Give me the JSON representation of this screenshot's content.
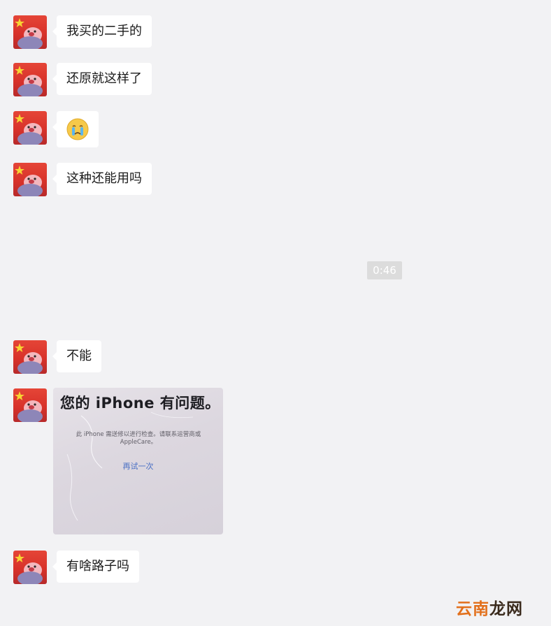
{
  "messages": [
    {
      "type": "text",
      "text": "我买的二手的"
    },
    {
      "type": "text",
      "text": "还原就这样了"
    },
    {
      "type": "emoji",
      "emoji": "crying-face-emoji"
    },
    {
      "type": "text",
      "text": "这种还能用吗"
    },
    {
      "type": "timestamp",
      "text": "0:46"
    },
    {
      "type": "text",
      "text": "不能"
    },
    {
      "type": "image",
      "title": "您的 iPhone 有问题。",
      "body": "此 iPhone 需送修以进行检查。请联系运营商或 AppleCare。",
      "link": "再试一次"
    },
    {
      "type": "text",
      "text": "有啥路子吗"
    }
  ],
  "watermark": {
    "part1": "云南",
    "part2": "龙网"
  },
  "colors": {
    "background": "#f2f2f4",
    "bubble": "#ffffff",
    "timestamp_bg": "#dcdcdc",
    "watermark_orange": "#e2701c"
  }
}
